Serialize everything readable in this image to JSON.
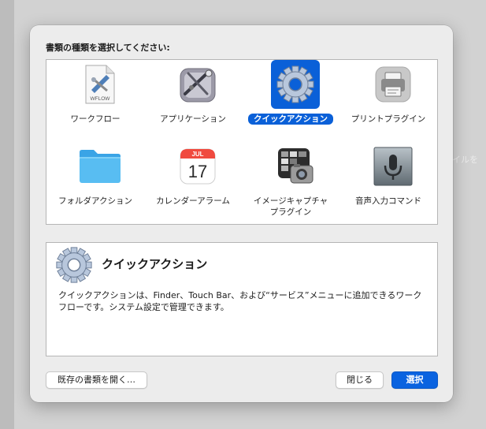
{
  "backdrop": {
    "partial_text": "イルを"
  },
  "dialog": {
    "prompt": "書類の種類を選択してください:",
    "types": [
      {
        "label": "ワークフロー",
        "icon": "workflow-document-icon",
        "badge": "WFLOW",
        "selected": false
      },
      {
        "label": "アプリケーション",
        "icon": "application-robot-icon",
        "selected": false
      },
      {
        "label": "クイックアクション",
        "icon": "gear-icon",
        "selected": true
      },
      {
        "label": "プリントプラグイン",
        "icon": "printer-icon",
        "selected": false
      },
      {
        "label": "フォルダアクション",
        "icon": "folder-icon",
        "selected": false
      },
      {
        "label": "カレンダーアラーム",
        "icon": "calendar-icon",
        "month": "JUL",
        "day": "17",
        "selected": false
      },
      {
        "label": "イメージキャプチャ\nプラグイン",
        "icon": "image-capture-icon",
        "selected": false
      },
      {
        "label": "音声入力コマンド",
        "icon": "microphone-icon",
        "selected": false
      }
    ],
    "description": {
      "title": "クイックアクション",
      "body": "クイックアクションは、Finder、Touch Bar、および“サービス”メニューに追加できるワークフローです。システム設定で管理できます。"
    },
    "buttons": {
      "open_existing": "既存の書類を開く…",
      "close": "閉じる",
      "choose": "選択"
    }
  },
  "colors": {
    "accent": "#0a60d8",
    "dialog_bg": "#ececec"
  }
}
